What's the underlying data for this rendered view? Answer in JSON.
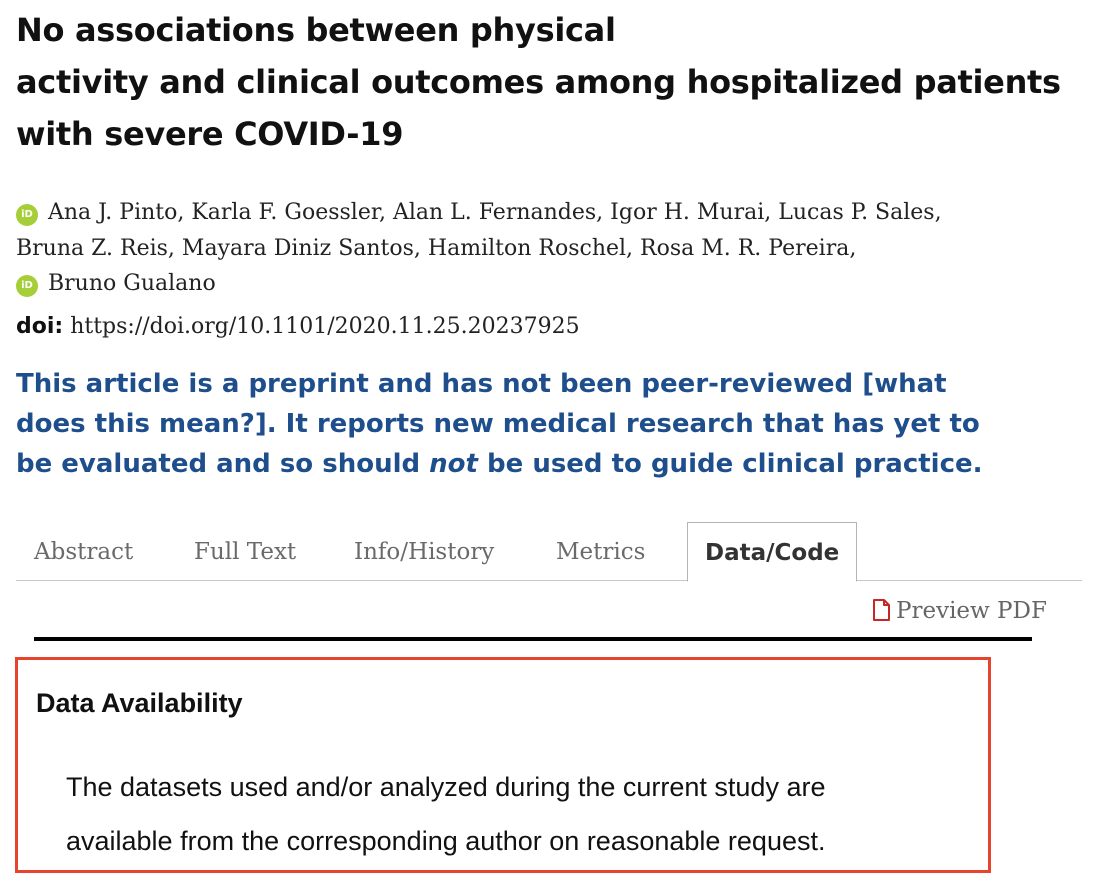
{
  "article": {
    "title_lines": [
      "No associations between physical",
      "activity and clinical outcomes among hospitalized patients",
      "with severe COVID-19"
    ],
    "orcid_label": "iD",
    "author_lines": [
      "Ana J. Pinto, Karla F. Goessler, Alan L. Fernandes, Igor H. Murai, Lucas P. Sales,",
      "Bruna Z. Reis, Mayara Diniz Santos, Hamilton Roschel, Rosa M. R. Pereira,",
      "Bruno Gualano"
    ],
    "doi_label": "doi:",
    "doi_value": "https://doi.org/10.1101/2020.11.25.20237925"
  },
  "notice": {
    "line1_before": "This article is a preprint and has not been peer-reviewed [",
    "line1_link": "what",
    "line2_link": "does this mean?",
    "line2_after": "]. It reports new medical research that has yet to",
    "line3_before": "be evaluated and so should ",
    "line3_emphasis": "not",
    "line3_after": " be used to guide clinical practice.",
    "color": "#1e4e8c"
  },
  "tabs": [
    {
      "label": "Abstract",
      "active": false
    },
    {
      "label": "Full Text",
      "active": false
    },
    {
      "label": "Info/History",
      "active": false
    },
    {
      "label": "Metrics",
      "active": false
    },
    {
      "label": "Data/Code",
      "active": true
    }
  ],
  "toolbar": {
    "preview_pdf_label": "Preview PDF"
  },
  "data_availability": {
    "heading": "Data Availability",
    "text_lines": [
      "The datasets used and/or analyzed during the current study are",
      "available from the corresponding author on reasonable request."
    ],
    "highlight_color": "#e8432c"
  }
}
